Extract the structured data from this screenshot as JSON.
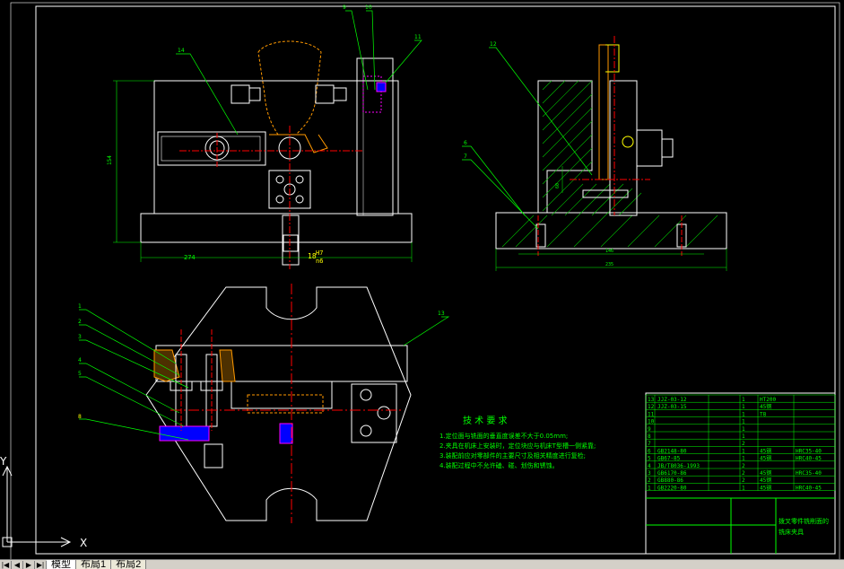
{
  "drawing": {
    "tech_requirements": {
      "title": "技 术 要 求",
      "items": [
        "1.定位面与铣面的垂直度误差不大于0.05mm;",
        "2.夹具在机床上安装时，定位块应与机床T型槽一侧紧靠;",
        "3.装配前应对零部件的主要尺寸及相关精度进行复检;",
        "4.装配过程中不允许磕、碰、划伤和锈蚀。"
      ]
    },
    "dims": {
      "front_width": "274",
      "front_height": "154",
      "fit": "18",
      "fit_upper": "H7",
      "fit_lower": "n6",
      "side_inner": "146",
      "side_outer": "235",
      "side_vertical": "60"
    },
    "callouts_top": [
      "9",
      "10",
      "11",
      "14",
      "12",
      "6",
      "7"
    ],
    "callouts_left": [
      "1",
      "2",
      "3",
      "4",
      "5",
      "8"
    ],
    "callout_plan": "13",
    "ucs": {
      "y": "Y",
      "x": "X"
    }
  },
  "title_block": {
    "drawing_name": [
      "拨叉零件铣削面的",
      "铣床夹具"
    ],
    "rows": [
      {
        "no": "13",
        "code": "JJZ-03-12",
        "qty": "1",
        "mat": "HT200",
        "note": ""
      },
      {
        "no": "12",
        "code": "JJZ-03-15",
        "qty": "1",
        "mat": "45钢",
        "note": ""
      },
      {
        "no": "11",
        "code": "",
        "qty": "1",
        "mat": "T8",
        "note": ""
      },
      {
        "no": "10",
        "code": "",
        "qty": "1",
        "mat": "",
        "note": ""
      },
      {
        "no": "9",
        "code": "",
        "qty": "1",
        "mat": "",
        "note": ""
      },
      {
        "no": "8",
        "code": "",
        "qty": "1",
        "mat": "",
        "note": ""
      },
      {
        "no": "7",
        "code": "",
        "qty": "2",
        "mat": "",
        "note": ""
      },
      {
        "no": "6",
        "code": "GB2148-80",
        "qty": "1",
        "mat": "45钢",
        "note": "HRC35-40"
      },
      {
        "no": "5",
        "code": "GB67-85",
        "qty": "1",
        "mat": "45钢",
        "note": "HRC40-45"
      },
      {
        "no": "4",
        "code": "JB/T8036-1993",
        "qty": "2",
        "mat": "",
        "note": ""
      },
      {
        "no": "3",
        "code": "GB6170-86",
        "qty": "2",
        "mat": "45钢",
        "note": "HRC35-40"
      },
      {
        "no": "2",
        "code": "GB880-86",
        "qty": "2",
        "mat": "45钢",
        "note": ""
      },
      {
        "no": "1",
        "code": "GB2220-80",
        "qty": "1",
        "mat": "45钢",
        "note": "HRC40-45"
      }
    ]
  },
  "layout_tabs": {
    "nav": [
      "|◀",
      "◀",
      "▶",
      "▶|"
    ],
    "tabs": [
      "模型",
      "布局1",
      "布局2"
    ]
  },
  "colors": {
    "background": "#000000",
    "outline": "#ffffff",
    "center_line": "#ff0000",
    "leader": "#00ff00",
    "hatch": "#00c000",
    "dimension": "#00ff00",
    "text_yellow": "#ffff00",
    "part_orange": "#ff9900",
    "part_magenta": "#ff00ff",
    "part_cyan": "#00ffff",
    "part_blue": "#0000ff"
  }
}
